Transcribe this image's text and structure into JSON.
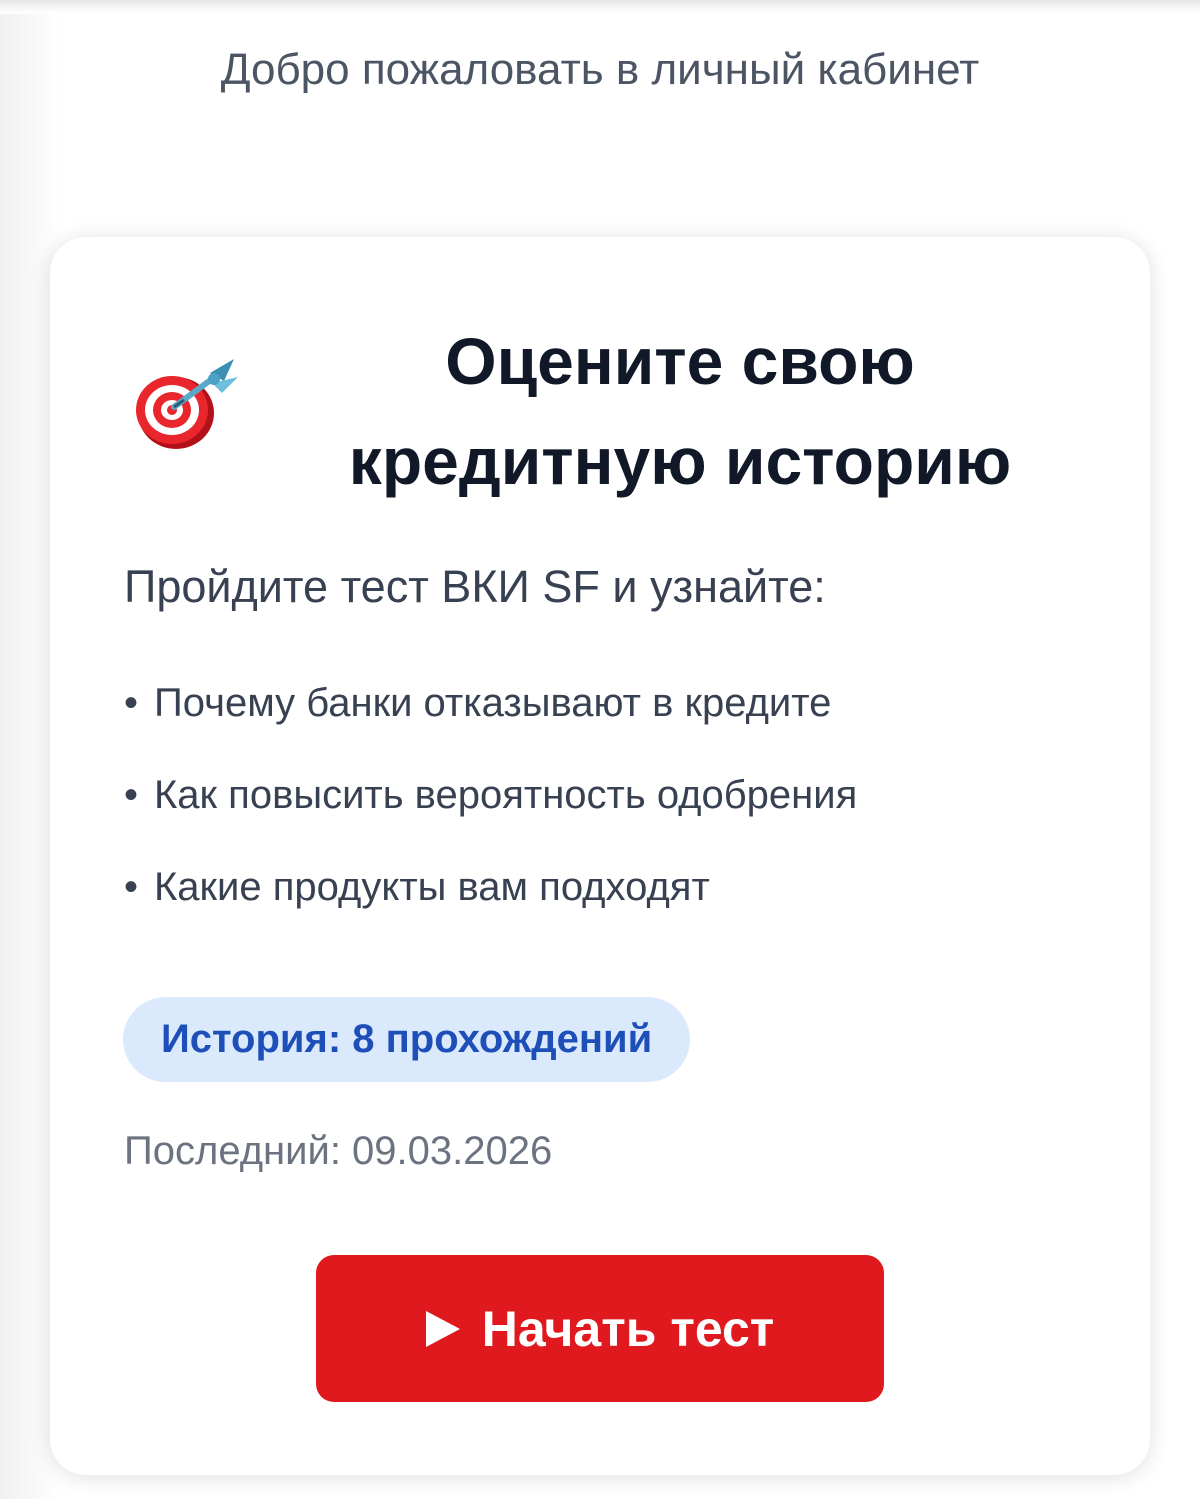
{
  "header": {
    "welcome_text": "Добро пожаловать в личный кабинет"
  },
  "card": {
    "icon": "target-dart-icon",
    "title_line1": "Оцените свою",
    "title_line2": "кредитную историю",
    "subtitle": "Пройдите тест ВКИ SF и узнайте:",
    "benefits": [
      "Почему банки отказывают в кредите",
      "Как повысить вероятность одобрения",
      "Какие продукты вам подходят"
    ],
    "bullet": "•",
    "history_badge": "История: 8 прохождений",
    "last_passed": "Последний: 09.03.2026",
    "start_button": {
      "icon": "play-icon",
      "label": "Начать тест"
    }
  },
  "colors": {
    "accent_red": "#e0191f",
    "badge_bg": "#dbe9fc",
    "badge_text": "#1e4fb8",
    "title_text": "#111827"
  }
}
